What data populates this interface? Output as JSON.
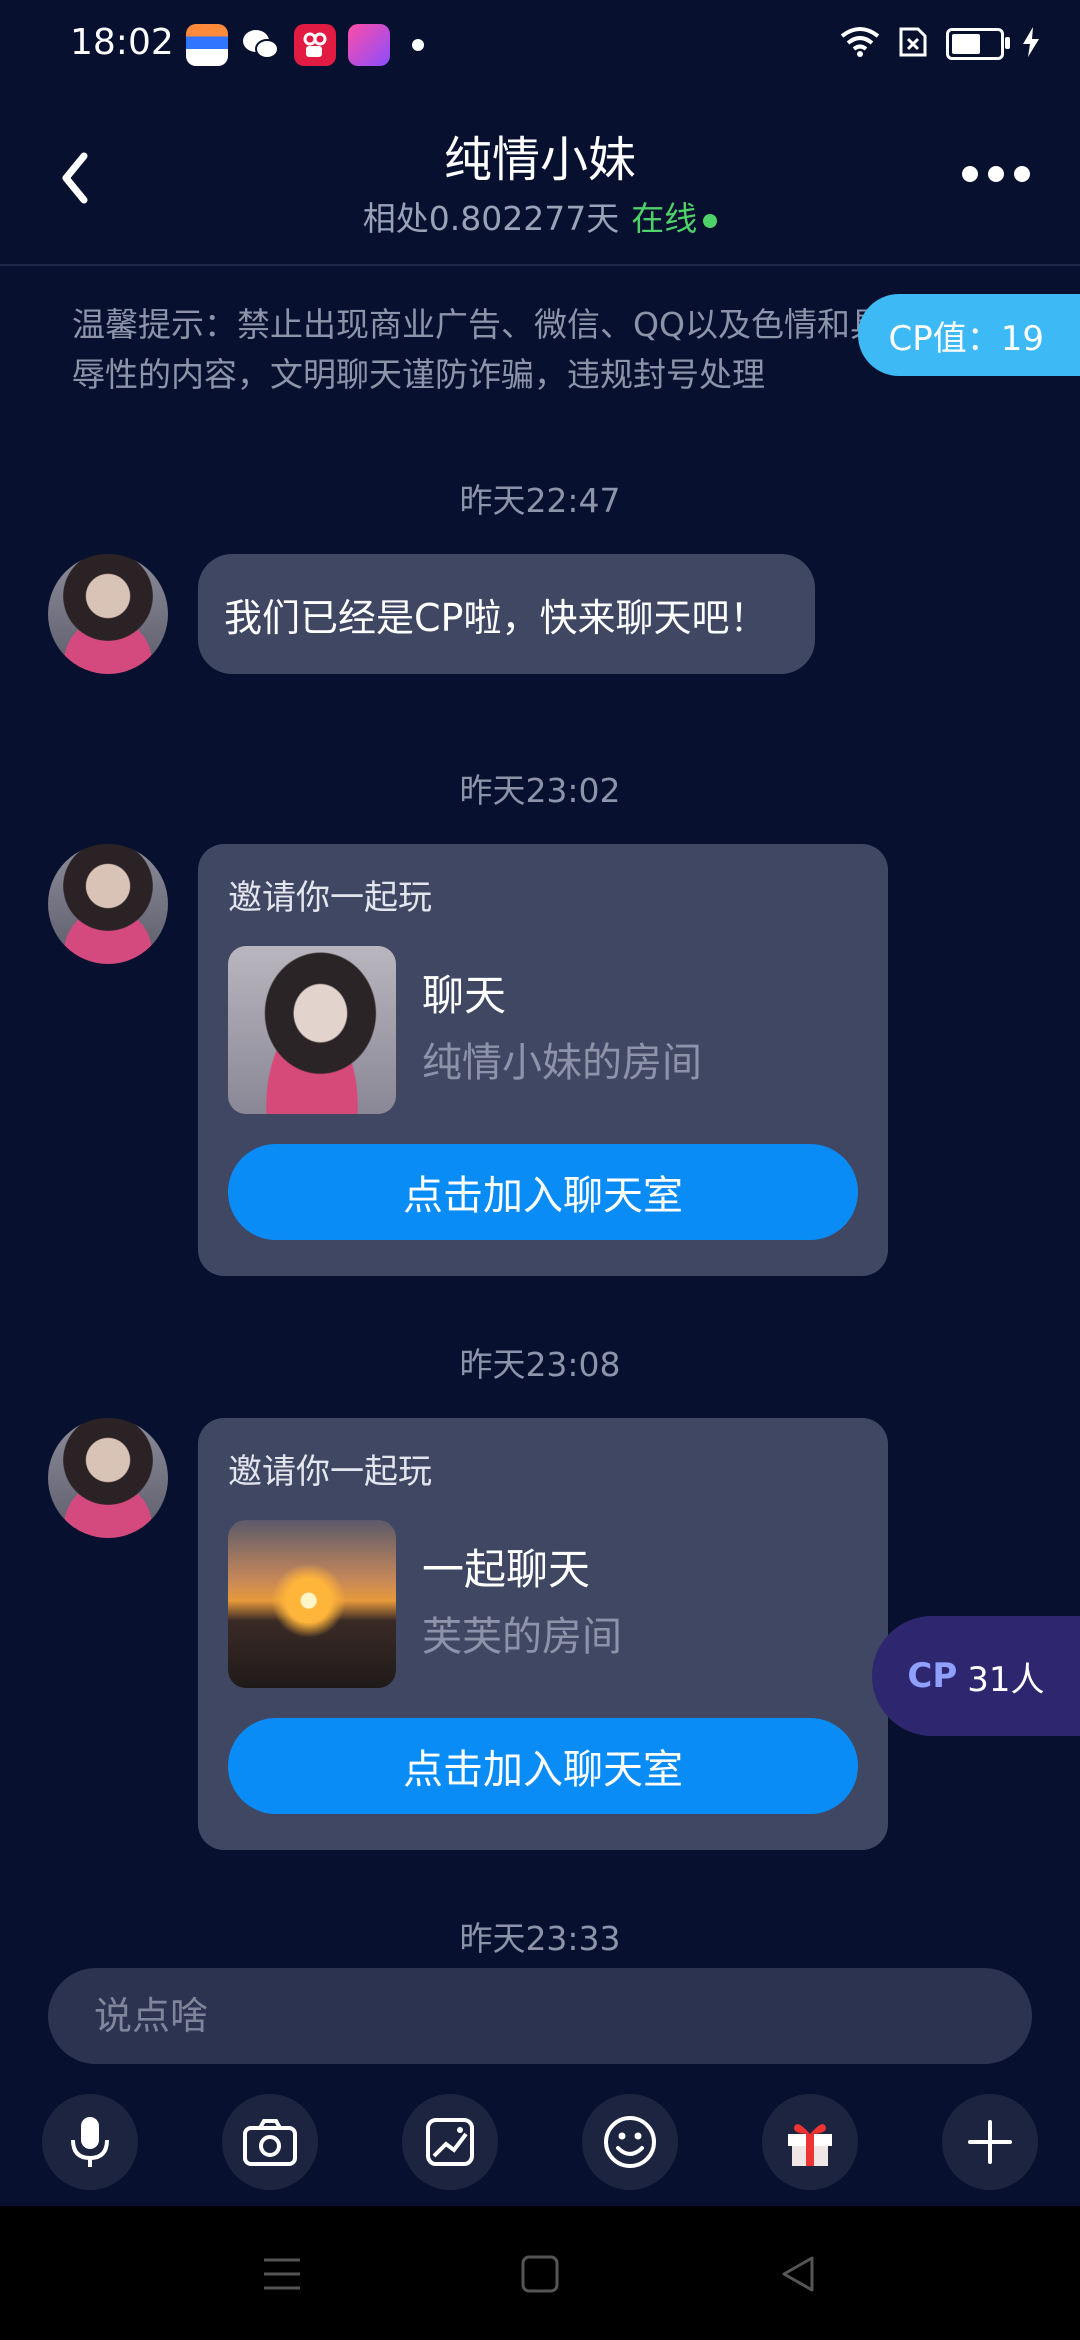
{
  "status_bar": {
    "time": "18:02"
  },
  "header": {
    "title": "纯情小妹",
    "days_together": "相处0.802277天",
    "online_status": "在线"
  },
  "notice": {
    "text": "温馨提示：禁止出现商业广告、微信、QQ以及色情和具有侮辱性的内容，文明聊天谨防诈骗，违规封号处理"
  },
  "cp_value": "CP值：19",
  "messages": [
    {
      "timestamp": "昨天22:47",
      "text": "我们已经是CP啦，快来聊天吧！"
    },
    {
      "timestamp": "昨天23:02",
      "invite_label": "邀请你一起玩",
      "room_name": "聊天",
      "room_owner": "纯情小妹的房间",
      "join_label": "点击加入聊天室"
    },
    {
      "timestamp": "昨天23:08",
      "invite_label": "邀请你一起玩",
      "room_name": "一起聊天",
      "room_owner": "芙芙的房间",
      "join_label": "点击加入聊天室"
    },
    {
      "timestamp": "昨天23:33"
    }
  ],
  "cp_count": {
    "prefix": "CP",
    "count": "31人"
  },
  "input": {
    "placeholder": "说点啥"
  },
  "toolbar": {
    "icons": [
      "microphone-icon",
      "camera-icon",
      "image-icon",
      "emoji-icon",
      "gift-icon",
      "plus-icon"
    ]
  },
  "colors": {
    "background": "#07102e",
    "accent": "#0a8cf7",
    "online": "#4fd16a",
    "cp_badge": "#3dbaf5"
  }
}
